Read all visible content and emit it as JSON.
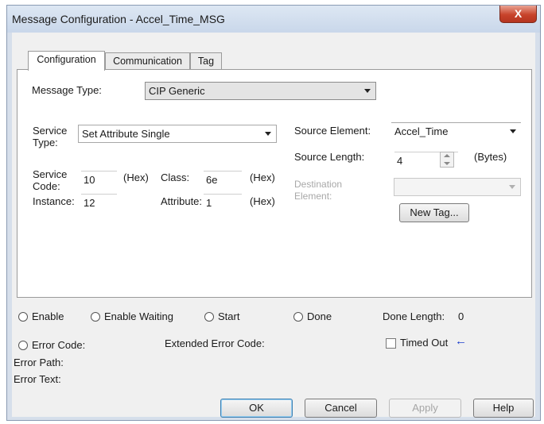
{
  "window": {
    "title": "Message Configuration - Accel_Time_MSG",
    "close_glyph": "X"
  },
  "tabs": [
    {
      "label": "Configuration",
      "active": true
    },
    {
      "label": "Communication",
      "active": false
    },
    {
      "label": "Tag",
      "active": false
    }
  ],
  "config": {
    "message_type_label": "Message Type:",
    "message_type_value": "CIP Generic",
    "service_type_label": "Service Type:",
    "service_type_value": "Set Attribute Single",
    "service_code_label": "Service Code:",
    "service_code_value": "10",
    "service_code_unit": "(Hex)",
    "class_label": "Class:",
    "class_value": "6e",
    "class_unit": "(Hex)",
    "instance_label": "Instance:",
    "instance_value": "12",
    "attribute_label": "Attribute:",
    "attribute_value": "1",
    "attribute_unit": "(Hex)",
    "source_element_label": "Source Element:",
    "source_element_value": "Accel_Time",
    "source_length_label": "Source Length:",
    "source_length_value": "4",
    "source_length_unit": "(Bytes)",
    "destination_element_label": "Destination Element:",
    "destination_element_value": "",
    "new_tag_label": "New Tag..."
  },
  "status": {
    "enable_label": "Enable",
    "enable_waiting_label": "Enable Waiting",
    "start_label": "Start",
    "done_label": "Done",
    "done_length_label": "Done Length:",
    "done_length_value": "0",
    "error_code_label": "Error Code:",
    "extended_error_code_label": "Extended Error Code:",
    "timed_out_label": "Timed Out",
    "timed_out_checked": false,
    "error_path_label": "Error Path:",
    "error_text_label": "Error Text:",
    "arrow_color": "#1a3ccc"
  },
  "buttons": {
    "ok": "OK",
    "cancel": "Cancel",
    "apply": "Apply",
    "help": "Help"
  }
}
